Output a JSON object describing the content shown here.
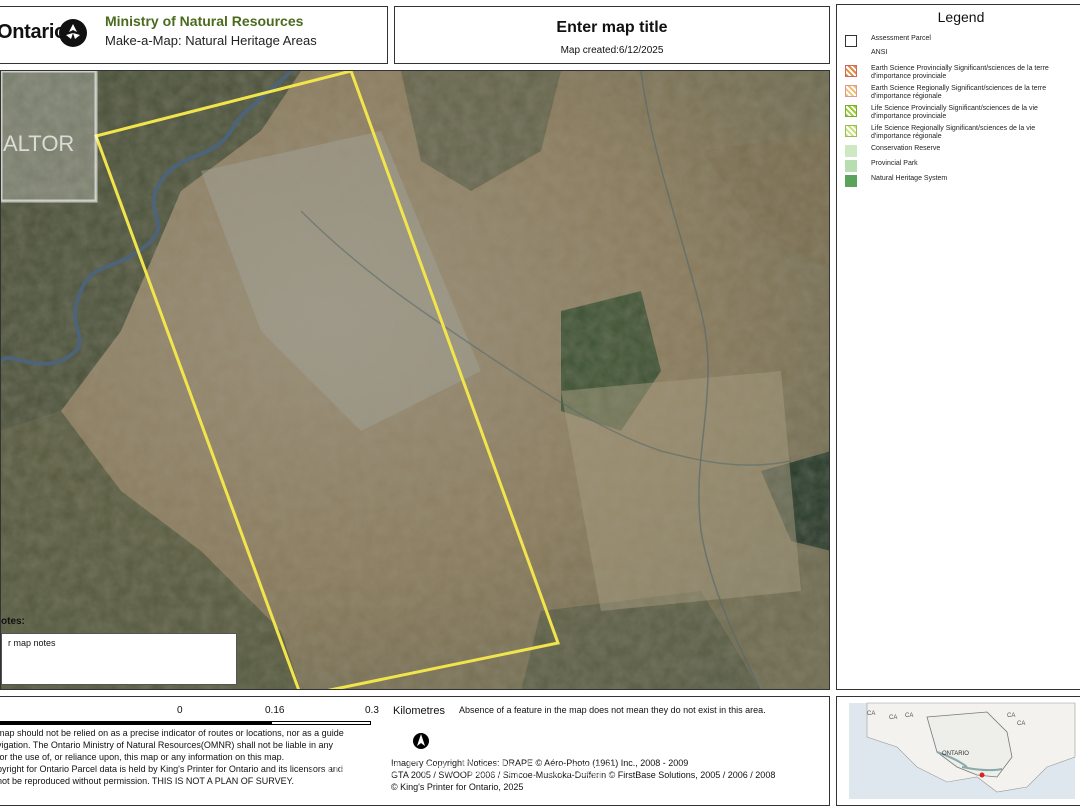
{
  "header": {
    "brand": "Ontario",
    "ministry": "Ministry of Natural Resources",
    "subtitle": "Make-a-Map: Natural Heritage Areas"
  },
  "map_title": {
    "title": "Enter map title",
    "created": "Map created:6/12/2025"
  },
  "legend": {
    "title": "Legend",
    "items": [
      {
        "label": "Assessment Parcel",
        "color": "#ffffff"
      },
      {
        "label": "ANSI",
        "color": ""
      },
      {
        "label": "Earth Science Provincially Significant/sciences de la terre d'importance provinciale",
        "color": "#e08a3a"
      },
      {
        "label": "Earth Science Regionally Significant/sciences de la terre d'importance régionale",
        "color": "#f0c070"
      },
      {
        "label": "Life Science Provincially Significant/sciences de la vie d'importance provinciale",
        "color": "#9acd32"
      },
      {
        "label": "Life Science Regionally Significant/sciences de la vie d'importance régionale",
        "color": "#c8e27a"
      },
      {
        "label": "Conservation Reserve",
        "color": "#cde8c2"
      },
      {
        "label": "Provincial Park",
        "color": "#b7ddb0"
      },
      {
        "label": "Natural Heritage System",
        "color": "#5aa35a"
      }
    ]
  },
  "map": {
    "notes_label": "otes:",
    "notes_text": "r map notes",
    "watermark": "Chestnut Park Realty/Heritage",
    "realtor_text": "ALTOR"
  },
  "scale": {
    "ticks": [
      "0",
      "0.16",
      "0.3"
    ],
    "unit": "Kilometres"
  },
  "bottom": {
    "absence_note": "Absence of a feature in the map does not mean they do not exist in this area.",
    "disclaimer_lines": [
      "map should not be relied on as a precise indicator of routes or locations, nor as a guide",
      "vigation. The Ontario Ministry of Natural Resources(OMNR) shall not be liable in any",
      "for the use of, or reliance upon, this map or any information on this map.",
      "pyright for Ontario Parcel data is held by King's Printer for Ontario and its licensors and",
      "not be reproduced without permission. THIS IS NOT A PLAN OF SURVEY."
    ],
    "credits_lines": [
      "Imagery Copyright Notices: DRAPE © Aéro-Photo (1961) Inc., 2008 - 2009",
      "GTA 2005 / SWOOP 2006 / Simcoe-Muskoka-Dufferin © FirstBase Solutions, 2005 / 2006 / 2008",
      "© King's Printer for Ontario,  2025"
    ]
  },
  "inset": {
    "labels": [
      "CA",
      "CA",
      "CA",
      "CA",
      "CA",
      "ONTARIO"
    ]
  }
}
